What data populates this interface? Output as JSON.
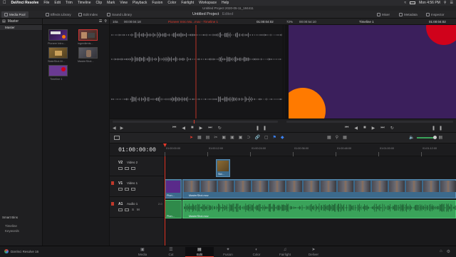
{
  "menubar": {
    "items": [
      "DaVinci Resolve",
      "File",
      "Edit",
      "Trim",
      "Timeline",
      "Clip",
      "Mark",
      "View",
      "Playback",
      "Fusion",
      "Color",
      "Fairlight",
      "Workspace",
      "Help"
    ],
    "clock": "Mon 4:56 PM"
  },
  "project": {
    "title_bar": "Untitled Project 2020-05-11_184411",
    "name": "Untitled Project",
    "status": "Edited"
  },
  "toolbar": {
    "media_pool": "Media Pool",
    "effects_library": "Effects Library",
    "edit_index": "Edit Index",
    "sound_library": "Sound Library",
    "mixer": "Mixer",
    "metadata": "Metadata",
    "inspector": "Inspector"
  },
  "sidebar": {
    "header": "Master",
    "items": [
      "Master"
    ],
    "smart_bins_header": "Smart Bins",
    "smart_bins": [
      "Timeline",
      "Keywords"
    ]
  },
  "pool": {
    "clips": [
      {
        "label": "Pioneer Intro..."
      },
      {
        "label": "ingredients..."
      },
      {
        "label": "SlateShot.M..."
      },
      {
        "label": "MasterShot..."
      },
      {
        "label": "Timeline 1"
      }
    ]
  },
  "source_viewer": {
    "zoom": "10a",
    "timecode_left": "00:00:04:18",
    "clip_name": "Pioneer Intro Mo...mov - Timeline 1",
    "timecode_right": "01:00:04:02"
  },
  "program_viewer": {
    "zoom": "72%",
    "timecode_left": "00:00:54:10",
    "timeline_name": "Timeline 1",
    "timecode_right": "01:00:04:02",
    "background_color": "#3b1f5c",
    "circle_top_color": "#d0021b",
    "circle_bottom_color": "#ff7a00"
  },
  "timeline": {
    "timecode": "01:00:00:00",
    "ruler": [
      "01:00:00:00",
      "01:00:12:00",
      "01:00:24:00",
      "01:00:36:00",
      "01:00:48:00",
      "01:01:00:00",
      "01:01:12:00"
    ],
    "tracks": [
      {
        "id": "V2",
        "name": "Video 2",
        "clips": [
          "Sld..."
        ]
      },
      {
        "id": "V1",
        "name": "Video 1",
        "clips": [
          "Pion...",
          "MasterShot.mov"
        ]
      },
      {
        "id": "A1",
        "name": "Audio 1",
        "level": "2.0",
        "clips": [
          "Pion...",
          "MasterShot.mov"
        ]
      }
    ]
  },
  "footer": {
    "app_name": "DaVinci Resolve 16"
  },
  "pages": [
    {
      "label": "Media",
      "icon": "media-icon"
    },
    {
      "label": "Cut",
      "icon": "cut-icon"
    },
    {
      "label": "Edit",
      "icon": "edit-icon"
    },
    {
      "label": "Fusion",
      "icon": "fusion-icon"
    },
    {
      "label": "Color",
      "icon": "color-icon"
    },
    {
      "label": "Fairlight",
      "icon": "fairlight-icon"
    },
    {
      "label": "Deliver",
      "icon": "deliver-icon"
    }
  ],
  "colors": {
    "video_clip": "#3c6a8c",
    "audio_clip": "#3aa35a",
    "playhead": "#e5392b",
    "active_page_underline": "#e5392b"
  }
}
